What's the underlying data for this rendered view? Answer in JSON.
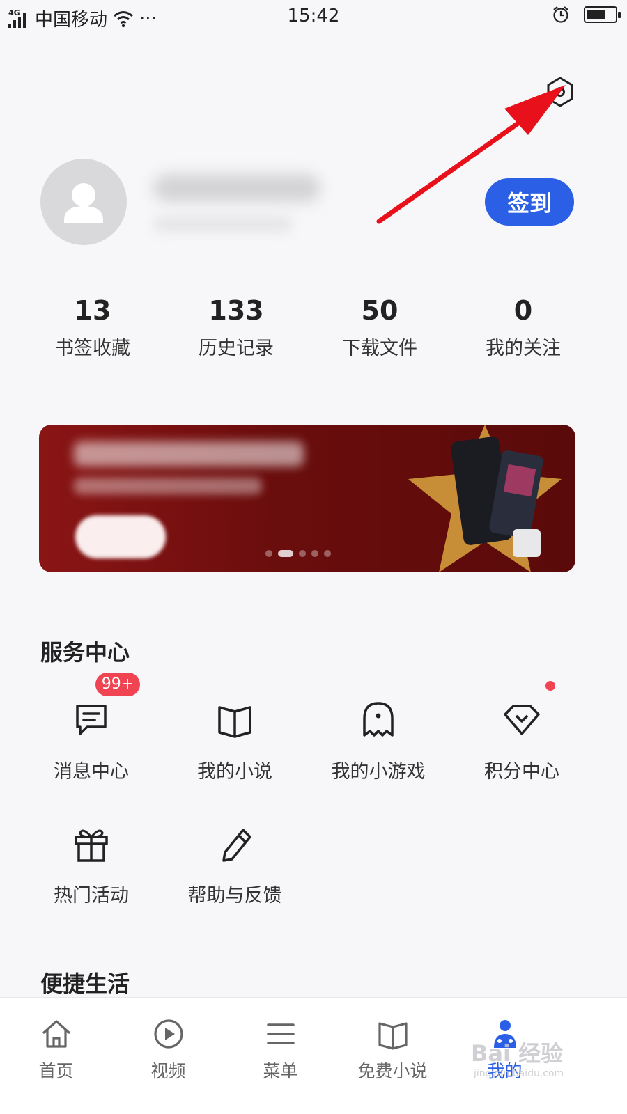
{
  "status_bar": {
    "network_tag": "4G",
    "carrier": "中国移动",
    "more": "···",
    "time": "15:42",
    "battery_level": 0.65,
    "icons": [
      "signal-icon",
      "wifi-icon",
      "alarm-icon",
      "battery-icon"
    ]
  },
  "header": {
    "settings_icon": "settings-hexagon-icon",
    "signin_label": "签到",
    "accent_color": "#2a5fe6",
    "annotation_color": "#e8101a"
  },
  "stats": [
    {
      "value": "13",
      "label": "书签收藏"
    },
    {
      "value": "133",
      "label": "历史记录"
    },
    {
      "value": "50",
      "label": "下载文件"
    },
    {
      "value": "0",
      "label": "我的关注"
    }
  ],
  "banner": {
    "slide_count": 5,
    "active_slide": 2
  },
  "service_center": {
    "title": "服务中心",
    "items": [
      {
        "label": "消息中心",
        "icon": "message-icon",
        "badge": "99+"
      },
      {
        "label": "我的小说",
        "icon": "book-icon"
      },
      {
        "label": "我的小游戏",
        "icon": "ghost-icon"
      },
      {
        "label": "积分中心",
        "icon": "diamond-icon",
        "dot": true
      },
      {
        "label": "热门活动",
        "icon": "gift-icon"
      },
      {
        "label": "帮助与反馈",
        "icon": "pencil-icon"
      }
    ]
  },
  "convenient_life": {
    "title": "便捷生活"
  },
  "bottom_nav": {
    "items": [
      {
        "label": "首页",
        "icon": "home-icon"
      },
      {
        "label": "视频",
        "icon": "play-icon"
      },
      {
        "label": "菜单",
        "icon": "menu-icon"
      },
      {
        "label": "免费小说",
        "icon": "book-icon"
      },
      {
        "label": "我的",
        "icon": "profile-icon",
        "active": true
      }
    ]
  },
  "watermark": {
    "main": "Bai 经验",
    "sub": "jingyan.baidu.com"
  }
}
